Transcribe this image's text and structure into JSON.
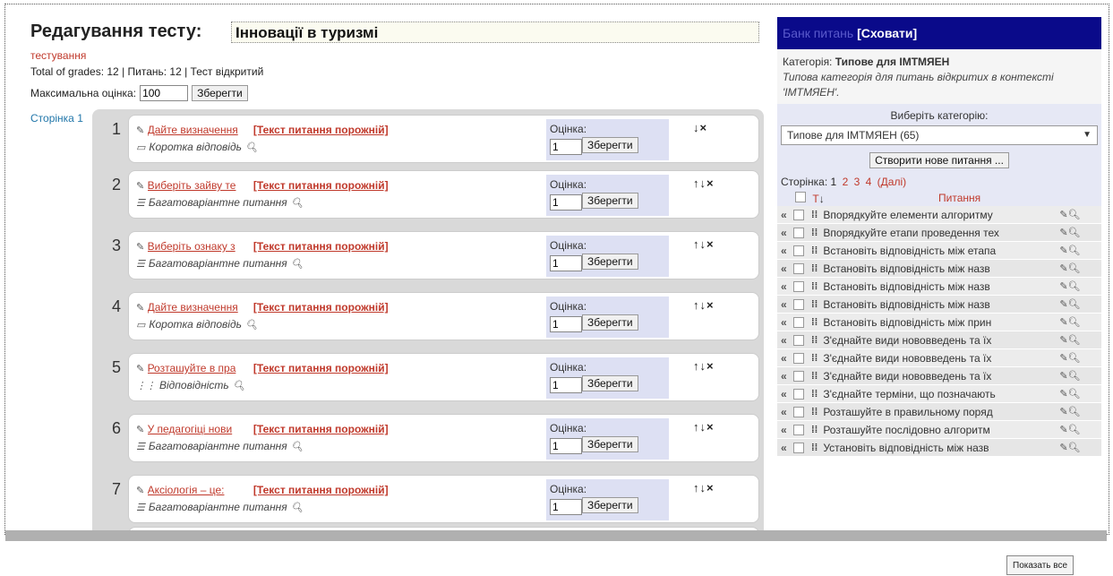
{
  "header": {
    "title": "Редагування тесту:",
    "test_name": "Інновації в туризмі",
    "sub_label": "тестування",
    "info": "Total of grades: 12 | Питань: 12 | Тест відкритий",
    "max_grade_label": "Максимальна оцінка:",
    "max_grade_value": "100",
    "save_label": "Зберегти"
  },
  "page_label": "Сторінка 1",
  "questions": [
    {
      "num": "1",
      "link": "Дайте визначення",
      "empty": "[Текст питання порожній]",
      "type": "Коротка відповідь",
      "grade_label": "Оцінка:",
      "grade": "1",
      "save": "Зберегти",
      "arrows": "↓×"
    },
    {
      "num": "2",
      "link": "Виберіть зайву те",
      "empty": "[Текст питання порожній]",
      "type": "Багатоваріантне питання",
      "grade_label": "Оцінка:",
      "grade": "1",
      "save": "Зберегти",
      "arrows": "↑↓×"
    },
    {
      "num": "3",
      "link": "Виберіть ознаку з",
      "empty": "[Текст питання порожній]",
      "type": "Багатоваріантне питання",
      "grade_label": "Оцінка:",
      "grade": "1",
      "save": "Зберегти",
      "arrows": "↑↓×"
    },
    {
      "num": "4",
      "link": "Дайте визначення",
      "empty": "[Текст питання порожній]",
      "type": "Коротка відповідь",
      "grade_label": "Оцінка:",
      "grade": "1",
      "save": "Зберегти",
      "arrows": "↑↓×"
    },
    {
      "num": "5",
      "link": "Розташуйте в пра",
      "empty": "[Текст питання порожній]",
      "type": "Відповідність",
      "grade_label": "Оцінка:",
      "grade": "1",
      "save": "Зберегти",
      "arrows": "↑↓×"
    },
    {
      "num": "6",
      "link": "У педагогіці нови",
      "empty": "[Текст питання порожній]",
      "type": "Багатоваріантне питання",
      "grade_label": "Оцінка:",
      "grade": "1",
      "save": "Зберегти",
      "arrows": "↑↓×"
    },
    {
      "num": "7",
      "link": "Аксіологія – це:",
      "empty": "[Текст питання порожній]",
      "type": "Багатоваріантне питання",
      "grade_label": "Оцінка:",
      "grade": "1",
      "save": "Зберегти",
      "arrows": "↑↓×"
    }
  ],
  "bank": {
    "title": "Банк питань",
    "hide_link": "[Сховати]",
    "category_prefix": "Категорія:",
    "category_name": "Типове для ІМТМЯЕН",
    "category_desc": "Типова категорія для питань відкритих в контексті 'ІМТМЯЕН'.",
    "choose_label": "Виберіть категорію:",
    "selected": "Типове для ІМТМЯЕН (65)",
    "create_label": "Створити нове питання ...",
    "pager_label": "Сторінка:",
    "pager_current": "1",
    "pager_pages": [
      "2",
      "3",
      "4"
    ],
    "pager_next": "(Далі)",
    "col_type": "Т",
    "col_question": "Питання",
    "rows": [
      "Впорядкуйте елементи алгоритму",
      "Впорядкуйте етапи проведення тех",
      "Встановіть відповідність між етапа",
      "Встановіть відповідність між назв",
      "Встановіть відповідність між назв",
      "Встановіть відповідність між назв",
      "Встановіть відповідність між прин",
      "З'єднайте види нововведень та їх",
      "З'єднайте види нововведень та їх",
      "З'єднайте види нововведень та їх",
      "З'єднайте терміни, що позначають",
      "Розташуйте в правильному поряд",
      "Розташуйте послідовно алгоритм",
      "Установіть відповідність між назв"
    ]
  },
  "bottom_button": "Показать все"
}
